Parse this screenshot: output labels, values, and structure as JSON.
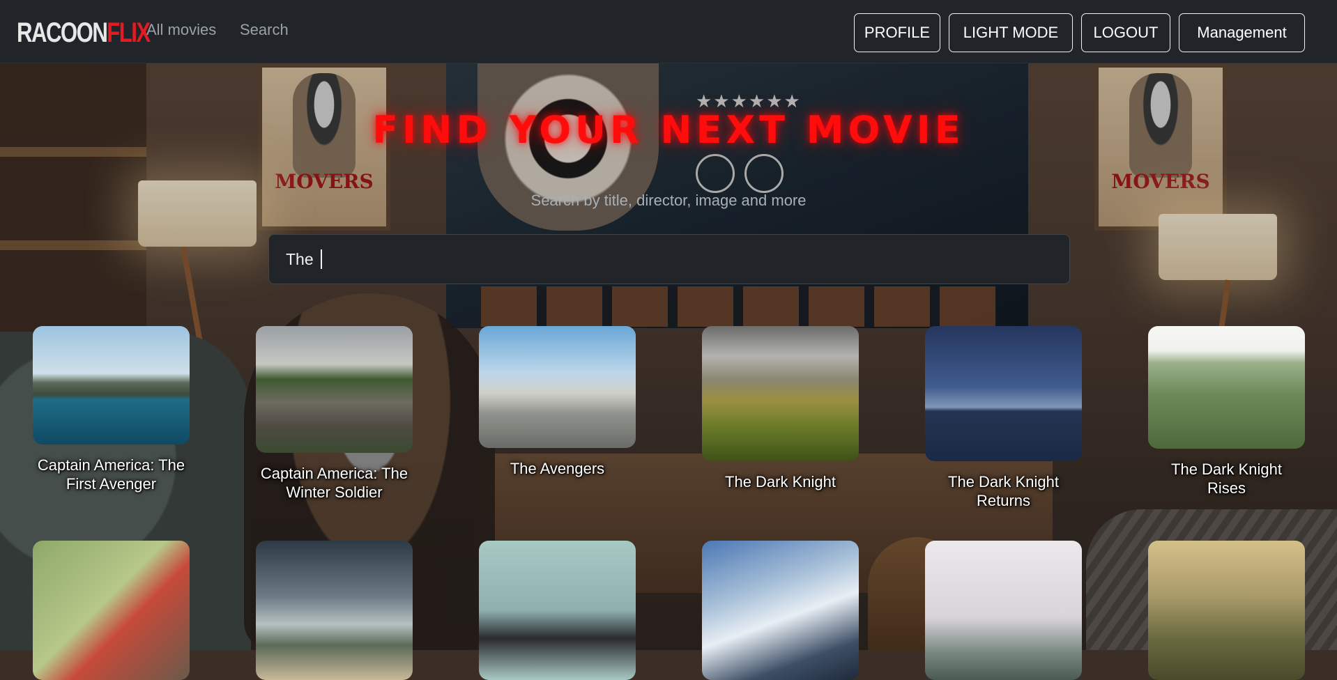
{
  "brand": {
    "part1": "RACOON",
    "part2": "FLIX"
  },
  "nav": {
    "links": [
      "All movies",
      "Search"
    ],
    "buttons": [
      "PROFILE",
      "LIGHT MODE",
      "LOGOUT",
      "Management"
    ]
  },
  "hero": {
    "title": "FIND YOUR NEXT MOVIE",
    "subtitle": "Search by title, director, image and more"
  },
  "search": {
    "value": "The "
  },
  "movies": [
    {
      "title": "Captain America: The First Avenger"
    },
    {
      "title": "Captain America: The Winter Soldier"
    },
    {
      "title": "The Avengers"
    },
    {
      "title": "The Dark Knight"
    },
    {
      "title": "The Dark Knight Returns"
    },
    {
      "title": "The Dark Knight Rises"
    }
  ],
  "colors": {
    "accent": "#e31b23",
    "nav_bg": "#212529"
  }
}
